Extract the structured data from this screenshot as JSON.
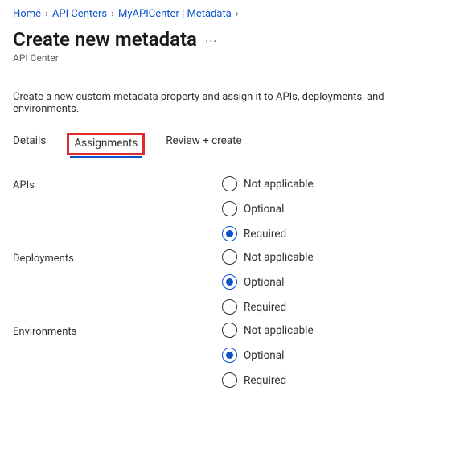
{
  "breadcrumb": {
    "items": [
      {
        "label": "Home"
      },
      {
        "label": "API Centers"
      },
      {
        "label": "MyAPICenter | Metadata"
      }
    ]
  },
  "page": {
    "title": "Create new metadata",
    "subtitle": "API Center",
    "description": "Create a new custom metadata property and assign it to APIs, deployments, and environments."
  },
  "tabs": {
    "items": [
      {
        "label": "Details",
        "active": false,
        "highlight": false
      },
      {
        "label": "Assignments",
        "active": true,
        "highlight": true
      },
      {
        "label": "Review + create",
        "active": false,
        "highlight": false
      }
    ]
  },
  "radioLabels": {
    "not_applicable": "Not applicable",
    "optional": "Optional",
    "required": "Required"
  },
  "assignments": {
    "groups": [
      {
        "label": "APIs",
        "selected": "required"
      },
      {
        "label": "Deployments",
        "selected": "optional"
      },
      {
        "label": "Environments",
        "selected": "optional"
      }
    ]
  }
}
